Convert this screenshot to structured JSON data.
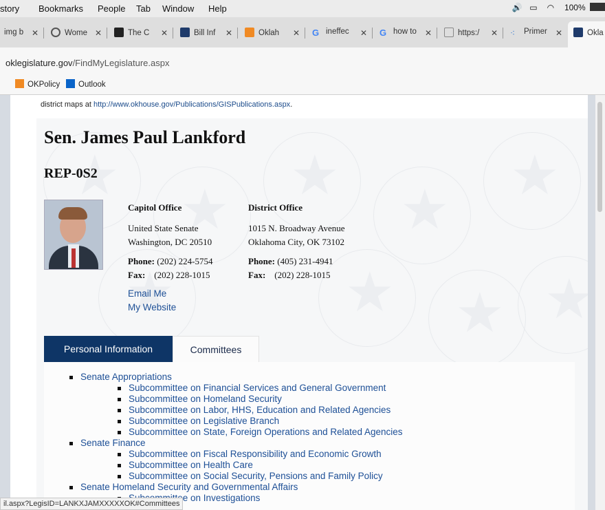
{
  "menubar": {
    "items": [
      "story",
      "Bookmarks",
      "People",
      "Tab",
      "Window",
      "Help"
    ],
    "battery": "100%"
  },
  "tabs": [
    {
      "label": "img b",
      "icon_color": "#ffffff"
    },
    {
      "label": "Wome",
      "icon_color": "#555555"
    },
    {
      "label": "The C",
      "icon_color": "#222222"
    },
    {
      "label": "Bill Inf",
      "icon_color": "#1f3b6b"
    },
    {
      "label": "Oklah",
      "icon_color": "#f08a24"
    },
    {
      "label": "ineffec",
      "icon_color": "#4285f4"
    },
    {
      "label": "how to",
      "icon_color": "#4285f4"
    },
    {
      "label": "https:/",
      "icon_color": "#888888"
    },
    {
      "label": "Primer",
      "icon_color": "#3f7fd1"
    },
    {
      "label": "Okla",
      "icon_color": "#1f3b6b"
    }
  ],
  "address": {
    "host": "oklegislature.gov",
    "path": "/FindMyLegislature.aspx"
  },
  "bookmarks": [
    {
      "label": "OKPolicy",
      "icon_color": "#f08a24"
    },
    {
      "label": "Outlook",
      "icon_color": "#0a64c9"
    }
  ],
  "page": {
    "intro_text": "district maps at ",
    "intro_link": "http://www.okhouse.gov/Publications/GISPublications.aspx",
    "intro_tail": ".",
    "name": "Sen. James Paul Lankford",
    "code": "REP-0S2",
    "capitol": {
      "heading": "Capitol Office",
      "line1": "United State Senate",
      "line2": "Washington, DC 20510",
      "phone_label": "Phone:",
      "phone": "(202) 224-5754",
      "fax_label": "Fax:",
      "fax": "(202) 228-1015"
    },
    "district": {
      "heading": "District Office",
      "line1": "1015 N. Broadway Avenue",
      "line2": "Oklahoma City, OK 73102",
      "phone_label": "Phone:",
      "phone": "(405) 231-4941",
      "fax_label": "Fax:",
      "fax": "(202) 228-1015"
    },
    "email_label": "Email Me",
    "website_label": "My Website",
    "tabs": {
      "personal": "Personal Information",
      "committees": "Committees"
    },
    "committees": [
      {
        "name": "Senate Appropriations",
        "subs": [
          "Subcommittee on Financial Services and General Government",
          "Subcommittee on Homeland Security",
          "Subcommittee on Labor, HHS, Education and Related Agencies",
          "Subcommittee on Legislative Branch",
          "Subcommittee on State, Foreign Operations and Related Agencies"
        ]
      },
      {
        "name": "Senate Finance",
        "subs": [
          "Subcommittee on Fiscal Responsibility and Economic Growth",
          "Subcommittee on Health Care",
          "Subcommittee on Social Security, Pensions and Family Policy"
        ]
      },
      {
        "name": "Senate Homeland Security and Governmental Affairs",
        "subs": [
          "Subcommittee on Investigations"
        ]
      }
    ]
  },
  "status_url": "il.aspx?LegisID=LANKXJAMXXXXXOK#Committees"
}
